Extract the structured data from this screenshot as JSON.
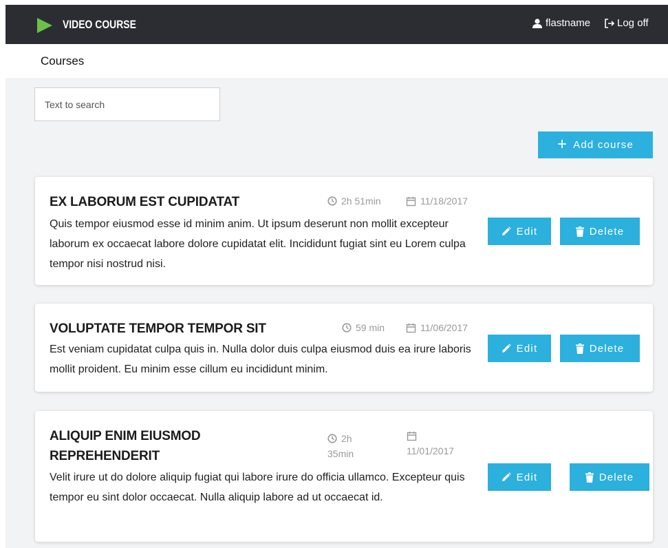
{
  "header": {
    "brand": "VIDEO COURSE",
    "username": "flastname",
    "logoff_label": "Log off",
    "logo_color": "#6cc04a",
    "background": "#2c2d33"
  },
  "subheader": {
    "title": "Courses"
  },
  "search": {
    "placeholder": "Text to search",
    "value": ""
  },
  "add_button": {
    "label": "Add course"
  },
  "accent_color": "#2cb0dd",
  "courses": [
    {
      "title": "EX LABORUM EST CUPIDATAT",
      "duration": "2h 51min",
      "date": "11/18/2017",
      "description": "Quis tempor eiusmod esse id minim anim. Ut ipsum deserunt non mollit excepteur laborum ex occaecat labore dolore cupidatat elit. Incididunt fugiat sint eu Lorem culpa tempor nisi nostrud nisi.",
      "edit_label": "Edit",
      "delete_label": "Delete"
    },
    {
      "title": "VOLUPTATE TEMPOR TEMPOR SIT",
      "duration": "59 min",
      "date": "11/06/2017",
      "description": "Est veniam cupidatat culpa quis in. Nulla dolor duis culpa eiusmod duis ea irure laboris mollit proident. Eu minim esse cillum eu incididunt minim.",
      "edit_label": "Edit",
      "delete_label": "Delete"
    },
    {
      "title": "ALIQUIP ENIM EIUSMOD REPREHENDERIT",
      "duration": "2h 35min",
      "date": "11/01/2017",
      "description": "Velit irure ut do dolore aliquip fugiat qui labore irure do officia ullamco. Excepteur quis tempor eu sint dolor occaecat. Nulla aliquip labore ad ut occaecat id.",
      "edit_label": "Edit",
      "delete_label": "Delete"
    }
  ]
}
